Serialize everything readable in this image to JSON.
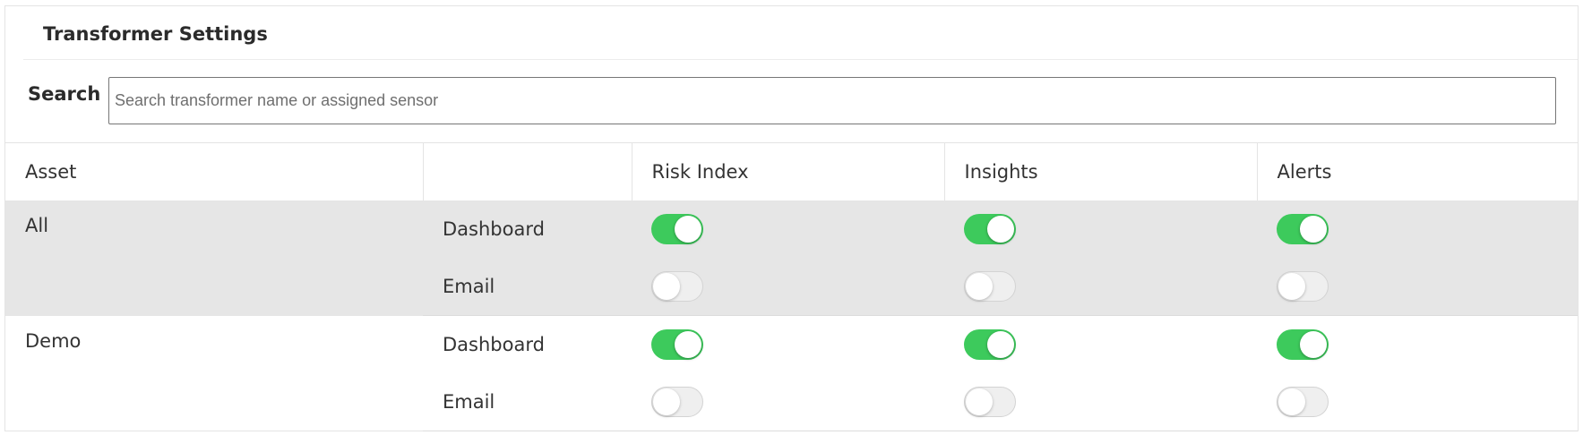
{
  "panel": {
    "title": "Transformer Settings"
  },
  "search": {
    "label": "Search",
    "value": "",
    "placeholder": "Search transformer name or assigned sensor"
  },
  "table": {
    "headers": [
      "Asset",
      "",
      "Risk Index",
      "Insights",
      "Alerts"
    ],
    "groups": [
      {
        "asset": "All",
        "rows": [
          {
            "channel": "Dashboard",
            "risk_index": true,
            "insights": true,
            "alerts": true
          },
          {
            "channel": "Email",
            "risk_index": false,
            "insights": false,
            "alerts": false
          }
        ]
      },
      {
        "asset": "Demo",
        "rows": [
          {
            "channel": "Dashboard",
            "risk_index": true,
            "insights": true,
            "alerts": true
          },
          {
            "channel": "Email",
            "risk_index": false,
            "insights": false,
            "alerts": false
          }
        ]
      }
    ]
  },
  "colors": {
    "toggle_on": "#3dca5c",
    "toggle_off": "#efefef",
    "shaded_row": "#e6e6e6"
  }
}
